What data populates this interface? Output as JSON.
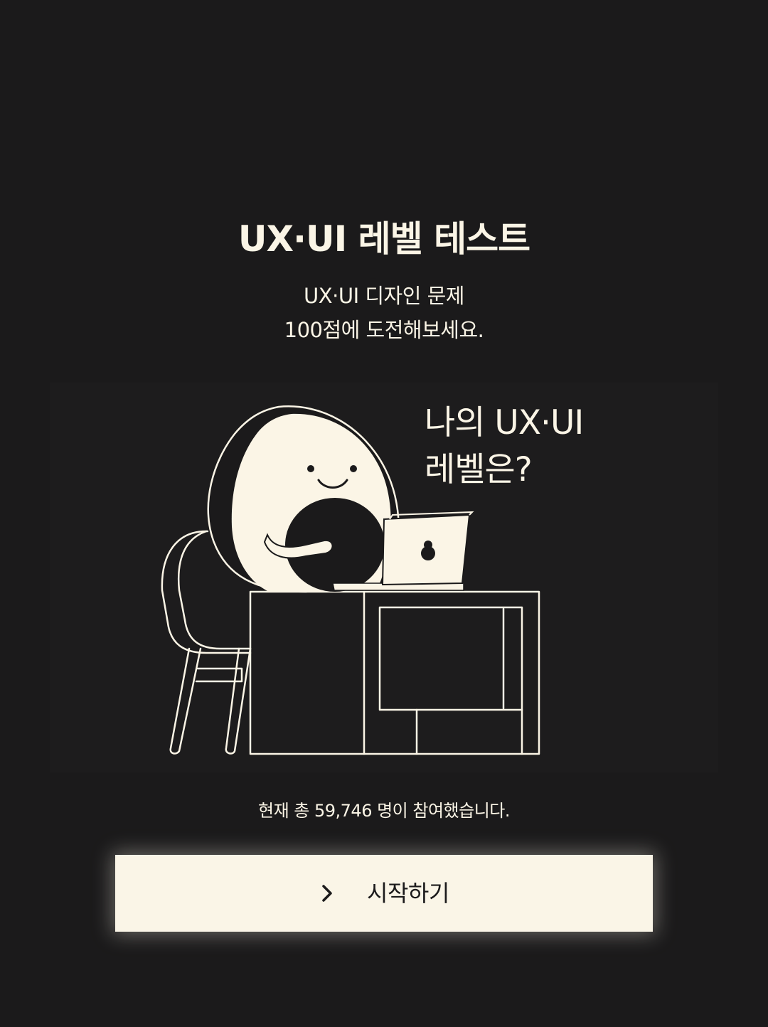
{
  "header": {
    "title": "UX·UI 레벨 테스트",
    "subtitle_line1": "UX·UI 디자인 문제",
    "subtitle_line2": "100점에 도전해보세요."
  },
  "illustration": {
    "speech_line1": "나의 UX·UI",
    "speech_line2": "레벨은?",
    "figure": "avocado-character-at-laptop",
    "colors": {
      "cream": "#fbf5e6",
      "dark": "#1b1a1b"
    }
  },
  "participants": {
    "text": "현재 총 59,746 명이 참여했습니다."
  },
  "start_button": {
    "label": "시작하기",
    "icon": "chevron-right-icon"
  },
  "theme": {
    "background": "#1b1a1b",
    "button_background": "#faf5e7",
    "text": "#fbf5e6"
  }
}
